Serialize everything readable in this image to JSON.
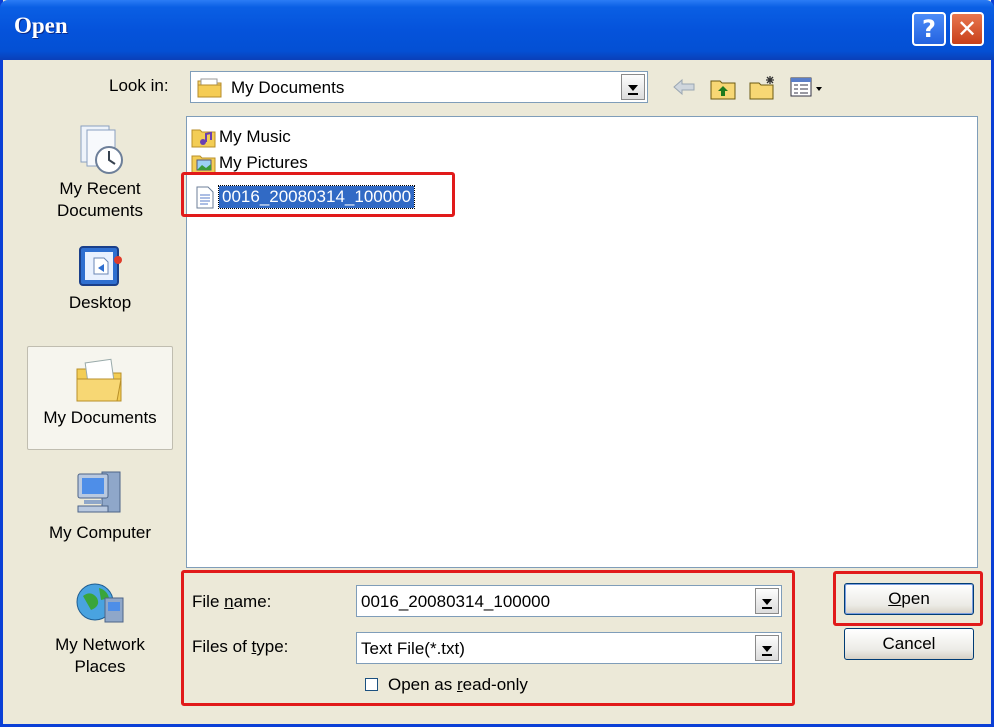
{
  "window": {
    "title": "Open",
    "help_glyph": "?",
    "close_glyph": "✕"
  },
  "lookin": {
    "label": "Look in:",
    "value": "My Documents"
  },
  "toolbar": {
    "icons": [
      "back-arrow-icon",
      "up-folder-icon",
      "new-folder-icon",
      "views-menu-icon"
    ]
  },
  "places": [
    {
      "label_line1": "My Recent",
      "label_line2": "Documents",
      "icon": "recent-documents-icon"
    },
    {
      "label_line1": "Desktop",
      "label_line2": "",
      "icon": "desktop-icon"
    },
    {
      "label_line1": "My Documents",
      "label_line2": "",
      "icon": "my-documents-icon"
    },
    {
      "label_line1": "My Computer",
      "label_line2": "",
      "icon": "my-computer-icon"
    },
    {
      "label_line1": "My Network",
      "label_line2": "Places",
      "icon": "network-places-icon"
    }
  ],
  "files": [
    {
      "name": "My Music",
      "type": "folder"
    },
    {
      "name": "My Pictures",
      "type": "folder"
    },
    {
      "name": "0016_20080314_100000",
      "type": "text-file",
      "selected": true
    }
  ],
  "filename": {
    "label_pre": "File ",
    "label_accel": "n",
    "label_post": "ame:",
    "value": "0016_20080314_100000"
  },
  "filetype": {
    "label_pre": "Files of ",
    "label_accel": "t",
    "label_post": "ype:",
    "value": "Text File(*.txt)"
  },
  "readonly": {
    "label_pre": "Open as ",
    "label_accel": "r",
    "label_post": "ead-only",
    "checked": false
  },
  "buttons": {
    "open_accel": "O",
    "open_rest": "pen",
    "cancel": "Cancel"
  },
  "highlight_color": "#e11a1a"
}
